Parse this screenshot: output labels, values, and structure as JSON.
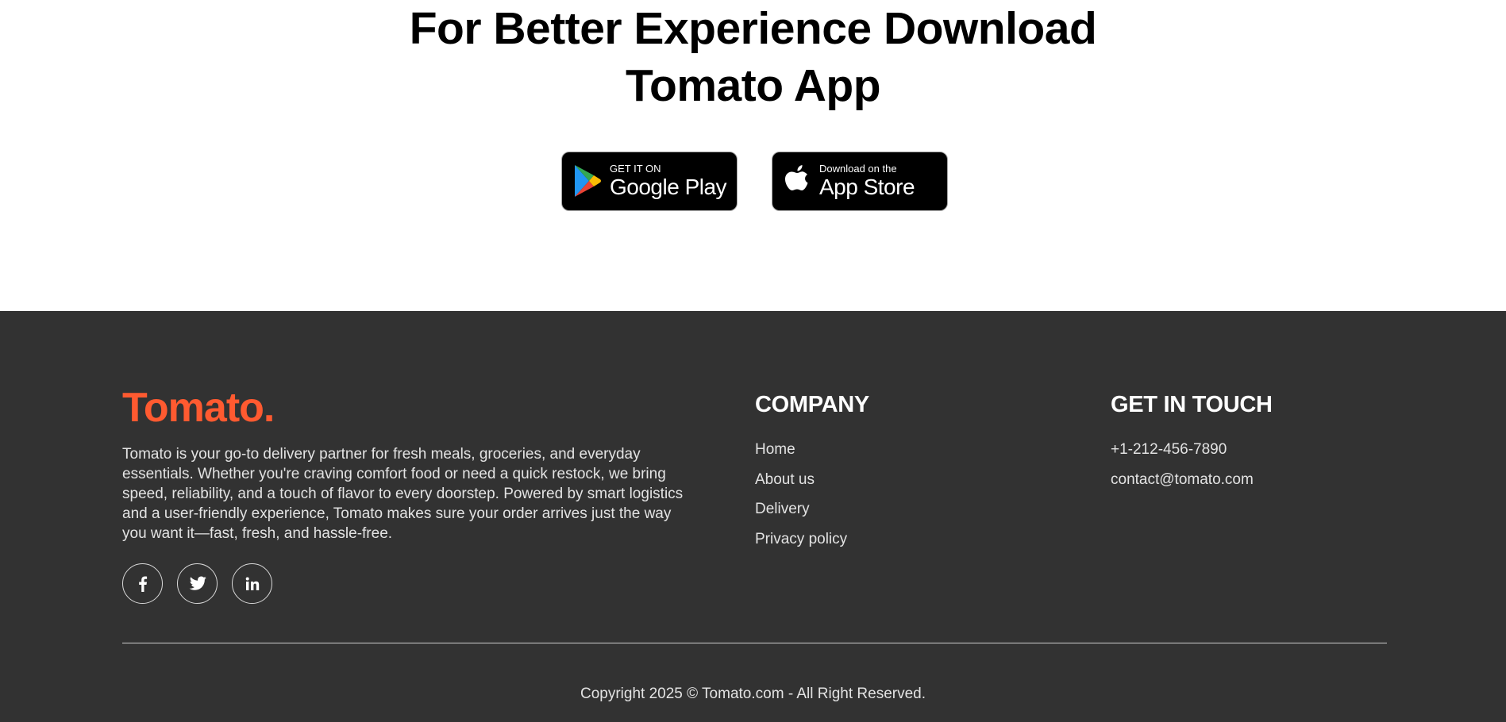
{
  "app_section": {
    "title_line1": "For Better Experience Download",
    "title_line2": "Tomato App",
    "google_play": {
      "small": "GET IT ON",
      "big": "Google Play",
      "icon": "google-play-icon"
    },
    "app_store": {
      "small": "Download on the",
      "big": "App Store",
      "icon": "apple-icon"
    }
  },
  "footer": {
    "logo": "Tomato.",
    "logo_color": "#ff5a30",
    "background": "#323232",
    "about": "Tomato is your go-to delivery partner for fresh meals, groceries, and everyday essentials. Whether you're craving comfort food or need a quick restock, we bring speed, reliability, and a touch of flavor to every doorstep. Powered by smart logistics and a user-friendly experience, Tomato makes sure your order arrives just the way you want it—fast, fresh, and hassle-free.",
    "socials": [
      "facebook-icon",
      "twitter-icon",
      "linkedin-icon"
    ],
    "company": {
      "heading": "COMPANY",
      "links": [
        "Home",
        "About us",
        "Delivery",
        "Privacy policy"
      ]
    },
    "get_in_touch": {
      "heading": "GET IN TOUCH",
      "phone": "+1-212-456-7890",
      "email": "contact@tomato.com"
    },
    "copyright": "Copyright 2025 © Tomato.com - All Right Reserved."
  }
}
